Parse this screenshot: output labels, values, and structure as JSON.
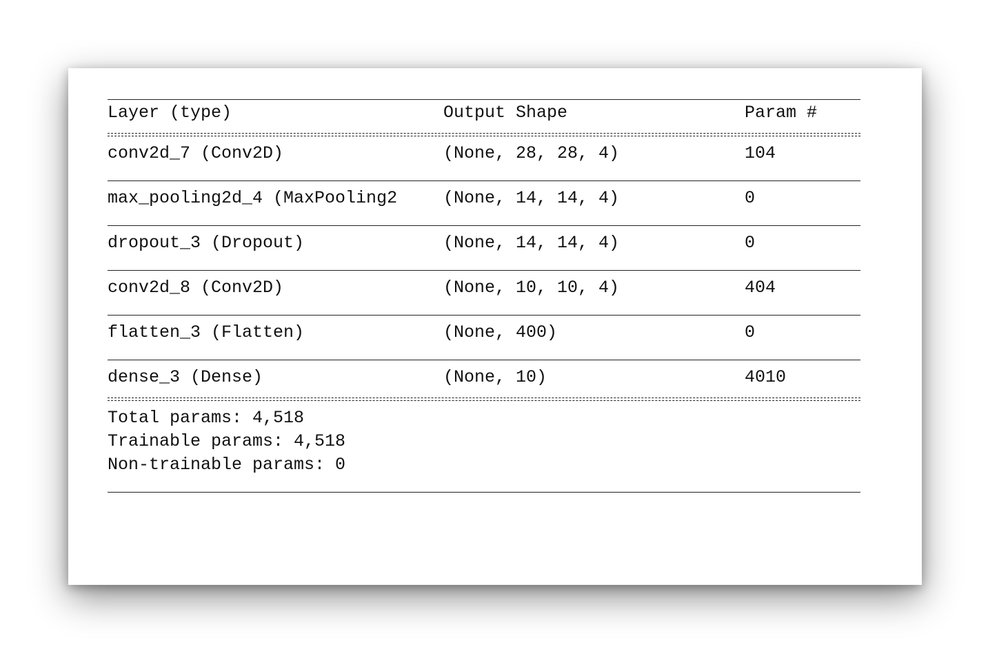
{
  "columns": {
    "layer": "Layer (type)",
    "output_shape": "Output Shape",
    "params": "Param #"
  },
  "layers": [
    {
      "name": "conv2d_7 (Conv2D)",
      "shape": "(None, 28, 28, 4)",
      "params": "104"
    },
    {
      "name": "max_pooling2d_4 (MaxPooling2",
      "shape": "(None, 14, 14, 4)",
      "params": "0"
    },
    {
      "name": "dropout_3 (Dropout)",
      "shape": "(None, 14, 14, 4)",
      "params": "0"
    },
    {
      "name": "conv2d_8 (Conv2D)",
      "shape": "(None, 10, 10, 4)",
      "params": "404"
    },
    {
      "name": "flatten_3 (Flatten)",
      "shape": "(None, 400)",
      "params": "0"
    },
    {
      "name": "dense_3 (Dense)",
      "shape": "(None, 10)",
      "params": "4010"
    }
  ],
  "totals": {
    "total": "Total params: 4,518",
    "trainable": "Trainable params: 4,518",
    "non_trainable": "Non-trainable params: 0"
  }
}
